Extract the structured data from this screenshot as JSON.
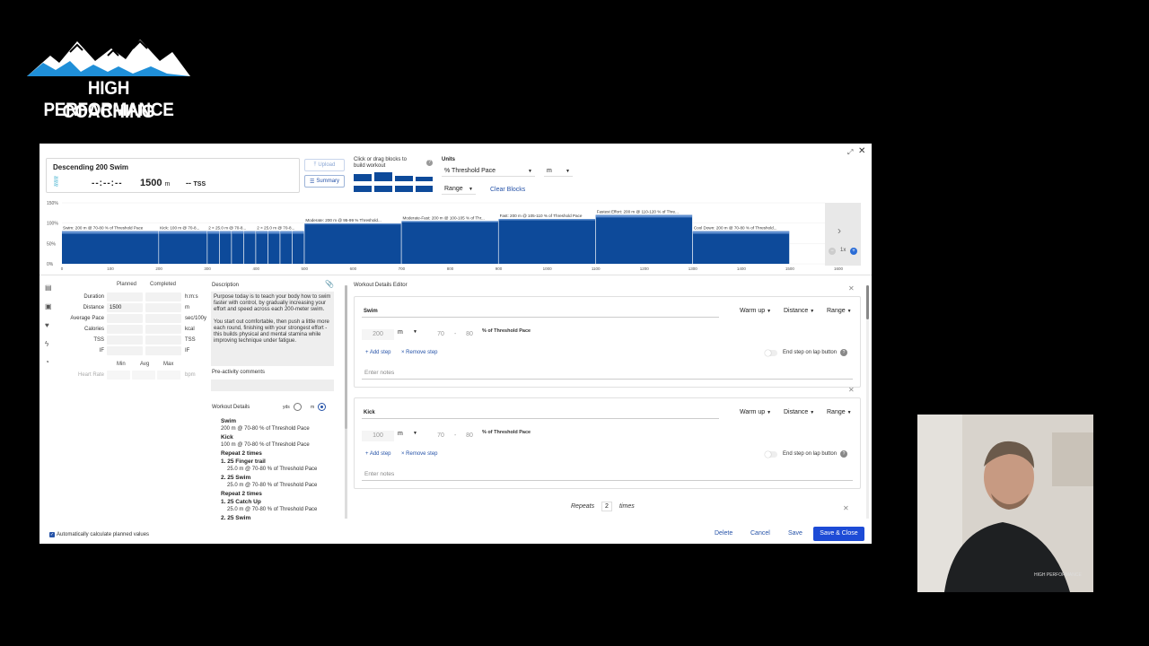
{
  "branding": {
    "line1": "HIGH PERFORMANCE",
    "line2": "COACHING"
  },
  "workout": {
    "title": "Descending 200 Swim",
    "duration": "--:--:--",
    "distance_value": "1500",
    "distance_unit": "m",
    "tss_value": "--",
    "tss_unit": "TSS"
  },
  "toolbar": {
    "upload_label": "Upload",
    "summary_label": "Summary",
    "blocks_hint": "Click or drag blocks to build workout",
    "units_label": "Units",
    "units_value": "% Threshold Pace",
    "unit_select": "m",
    "range_select": "Range",
    "clear_blocks": "Clear Blocks"
  },
  "chart_data": {
    "type": "bar",
    "y_ticks": [
      "150%",
      "100%",
      "50%",
      "0%"
    ],
    "x_ticks": [
      "0",
      "100",
      "200",
      "300",
      "400",
      "500",
      "600",
      "700",
      "800",
      "900",
      "1000",
      "1100",
      "1200",
      "1300",
      "1400",
      "1500",
      "1600"
    ],
    "xlim": [
      0,
      1600
    ],
    "ylim": [
      0,
      150
    ],
    "segments": [
      {
        "start": 0,
        "end": 200,
        "low": 70,
        "high": 80,
        "label": "Swim: 200 m @ 70-80 % of Threshold Pace"
      },
      {
        "start": 200,
        "end": 300,
        "low": 70,
        "high": 80,
        "label": "Kick: 100 m @ 70-8..."
      },
      {
        "start": 300,
        "end": 325,
        "low": 70,
        "high": 80,
        "label": "2 × 25.0 m @ 70-8..."
      },
      {
        "start": 325,
        "end": 350,
        "low": 70,
        "high": 80,
        "label": ""
      },
      {
        "start": 350,
        "end": 375,
        "low": 70,
        "high": 80,
        "label": ""
      },
      {
        "start": 375,
        "end": 400,
        "low": 70,
        "high": 80,
        "label": ""
      },
      {
        "start": 400,
        "end": 425,
        "low": 70,
        "high": 80,
        "label": "2 × 25.0 m @ 70-8..."
      },
      {
        "start": 425,
        "end": 450,
        "low": 70,
        "high": 80,
        "label": ""
      },
      {
        "start": 450,
        "end": 475,
        "low": 70,
        "high": 80,
        "label": ""
      },
      {
        "start": 475,
        "end": 500,
        "low": 70,
        "high": 80,
        "label": ""
      },
      {
        "start": 500,
        "end": 700,
        "low": 95,
        "high": 99,
        "label": "Moderate: 200 m @ 95-99 % Threshold..."
      },
      {
        "start": 700,
        "end": 900,
        "low": 100,
        "high": 105,
        "label": "Moderate-Fast: 200 m @ 100-105 % of Thr..."
      },
      {
        "start": 900,
        "end": 1100,
        "low": 105,
        "high": 110,
        "label": "Fast: 200 m @ 105-110 % of Threshold Pace"
      },
      {
        "start": 1100,
        "end": 1300,
        "low": 110,
        "high": 120,
        "label": "Fastest Effort: 200 m @ 110-120 % of Thre..."
      },
      {
        "start": 1300,
        "end": 1500,
        "low": 70,
        "high": 80,
        "label": "Cool Down: 200 m @ 70-80 % of Threshold..."
      }
    ]
  },
  "zoom": {
    "label": "1x"
  },
  "metrics": {
    "planned_head": "Planned",
    "completed_head": "Completed",
    "rows": [
      {
        "label": "Duration",
        "planned": "",
        "unit": "h:m:s"
      },
      {
        "label": "Distance",
        "planned": "1500",
        "unit": "m"
      },
      {
        "label": "Average Pace",
        "planned": "",
        "unit": "sec/100y"
      },
      {
        "label": "Calories",
        "planned": "",
        "unit": "kcal"
      },
      {
        "label": "TSS",
        "planned": "",
        "unit": "TSS"
      },
      {
        "label": "IF",
        "planned": "",
        "unit": "IF"
      }
    ],
    "hr_min": "Min",
    "hr_avg": "Avg",
    "hr_max": "Max",
    "hr_label": "Heart Rate",
    "hr_unit": "bpm"
  },
  "description": {
    "label": "Description",
    "para1": "Purpose today is to teach your body how to swim faster with control, by gradually increasing your effort and speed across each 200-meter swim.",
    "para2": "You start out comfortable, then push a little more each round, finishing with your strongest effort - this builds physical and mental stamina while improving technique under fatigue.",
    "preactivity_label": "Pre-activity comments"
  },
  "workout_details": {
    "label": "Workout Details",
    "yds": "yds",
    "m": "m",
    "lines": [
      {
        "text": "Swim",
        "bold": true,
        "indent": false
      },
      {
        "text": "200 m @ 70-80 % of Threshold Pace",
        "bold": false,
        "indent": false
      },
      {
        "text": "Kick",
        "bold": true,
        "indent": false
      },
      {
        "text": "100 m @ 70-80 % of Threshold Pace",
        "bold": false,
        "indent": false
      },
      {
        "text": "Repeat 2 times",
        "bold": true,
        "indent": false
      },
      {
        "text": "1. 25 Finger trail",
        "bold": true,
        "indent": false
      },
      {
        "text": "25.0 m @ 70-80 % of Threshold Pace",
        "bold": false,
        "indent": true
      },
      {
        "text": "2. 25 Swim",
        "bold": true,
        "indent": false
      },
      {
        "text": "25.0 m @ 70-80 % of Threshold Pace",
        "bold": false,
        "indent": true
      },
      {
        "text": "Repeat 2 times",
        "bold": true,
        "indent": false
      },
      {
        "text": "1. 25 Catch Up",
        "bold": true,
        "indent": false
      },
      {
        "text": "25.0 m @ 70-80 % of Threshold Pace",
        "bold": false,
        "indent": true
      },
      {
        "text": "2. 25 Swim",
        "bold": true,
        "indent": false
      }
    ]
  },
  "editor": {
    "label": "Workout Details Editor",
    "add_step": "+ Add step",
    "remove_step": "× Remove step",
    "lap_label": "End step on lap button",
    "notes_placeholder": "Enter notes",
    "tp_label": "% of Threshold Pace",
    "steps": [
      {
        "name": "Swim",
        "type": "Warm up",
        "measure": "Distance",
        "range": "Range",
        "qty": "200",
        "unit": "m",
        "low": "70",
        "high": "80"
      },
      {
        "name": "Kick",
        "type": "Warm up",
        "measure": "Distance",
        "range": "Range",
        "qty": "100",
        "unit": "m",
        "low": "70",
        "high": "80"
      }
    ],
    "repeats_label": "Repeats",
    "repeats_count": "2",
    "repeats_times": "times"
  },
  "footer": {
    "auto_calc": "Automatically calculate planned values",
    "delete": "Delete",
    "cancel": "Cancel",
    "save": "Save",
    "save_close": "Save & Close"
  }
}
